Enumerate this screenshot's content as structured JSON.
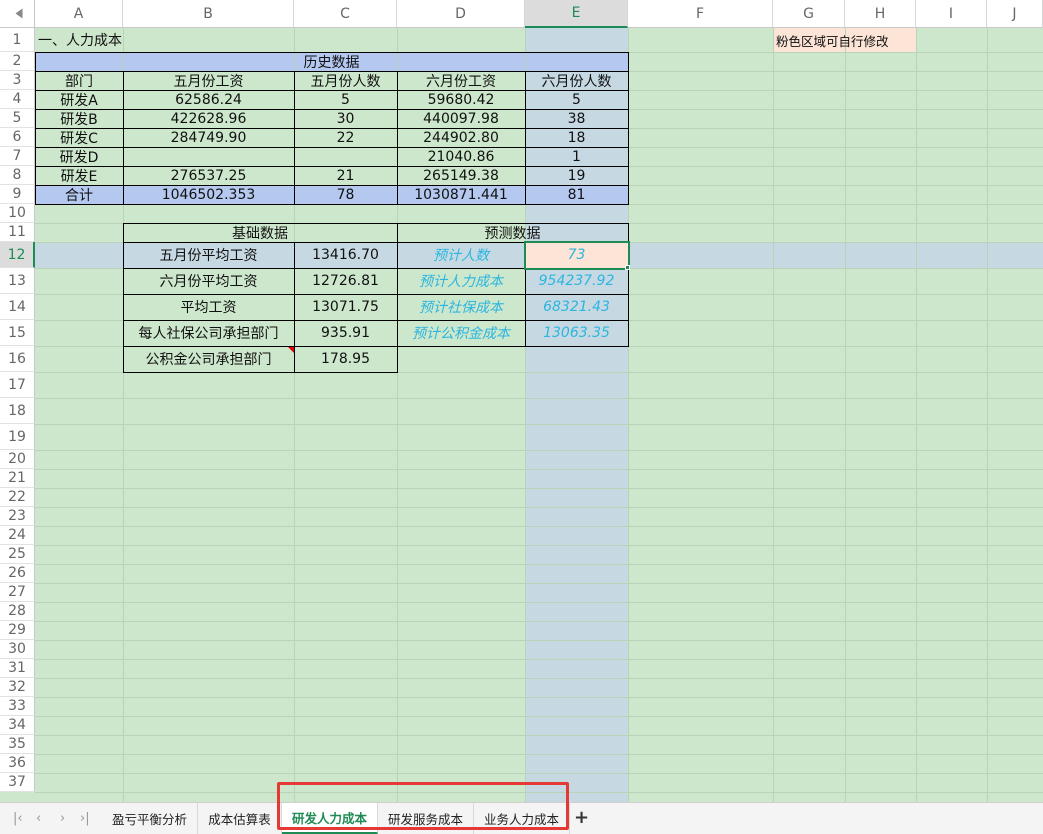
{
  "columns": [
    "A",
    "B",
    "C",
    "D",
    "E",
    "F",
    "G",
    "H",
    "I",
    "J"
  ],
  "selected_column": "E",
  "rows": [
    "1",
    "2",
    "3",
    "4",
    "5",
    "6",
    "7",
    "8",
    "9",
    "10",
    "11",
    "12",
    "13",
    "14",
    "15",
    "16",
    "17",
    "18",
    "19",
    "20",
    "21",
    "22",
    "23",
    "24",
    "25",
    "26",
    "27",
    "28",
    "29",
    "30",
    "31",
    "32",
    "33",
    "34",
    "35",
    "36",
    "37"
  ],
  "selected_row": "12",
  "section_title": "一、人力成本",
  "note": "粉色区域可自行修改",
  "history": {
    "title": "历史数据",
    "headers": [
      "部门",
      "五月份工资",
      "五月份人数",
      "六月份工资",
      "六月份人数"
    ],
    "rows": [
      [
        "研发A",
        "62586.24",
        "5",
        "59680.42",
        "5"
      ],
      [
        "研发B",
        "422628.96",
        "30",
        "440097.98",
        "38"
      ],
      [
        "研发C",
        "284749.90",
        "22",
        "244902.80",
        "18"
      ],
      [
        "研发D",
        "",
        "",
        "21040.86",
        "1"
      ],
      [
        "研发E",
        "276537.25",
        "21",
        "265149.38",
        "19"
      ],
      [
        "合计",
        "1046502.353",
        "78",
        "1030871.441",
        "81"
      ]
    ]
  },
  "basic": {
    "title": "基础数据",
    "rows": [
      [
        "五月份平均工资",
        "13416.70"
      ],
      [
        "六月份平均工资",
        "12726.81"
      ],
      [
        "平均工资",
        "13071.75"
      ],
      [
        "每人社保公司承担部门",
        "935.91"
      ],
      [
        "公积金公司承担部门",
        "178.95"
      ]
    ]
  },
  "forecast": {
    "title": "预测数据",
    "rows": [
      [
        "预计人数",
        "73"
      ],
      [
        "预计人力成本",
        "954237.92"
      ],
      [
        "预计社保成本",
        "68321.43"
      ],
      [
        "预计公积金成本",
        "13063.35"
      ]
    ]
  },
  "tabs": [
    "盈亏平衡分析",
    "成本估算表",
    "研发人力成本",
    "研发服务成本",
    "业务人力成本"
  ],
  "active_tab": "研发人力成本",
  "colors": {
    "grid_bg": "#cde7cc",
    "header_blue": "#b4c8f0",
    "pink": "#fce4d6",
    "selected_col": "#c6d9e3",
    "accent_green": "#1e8b55",
    "forecast_text": "#2cb5df",
    "highlight_box": "#e53935"
  }
}
